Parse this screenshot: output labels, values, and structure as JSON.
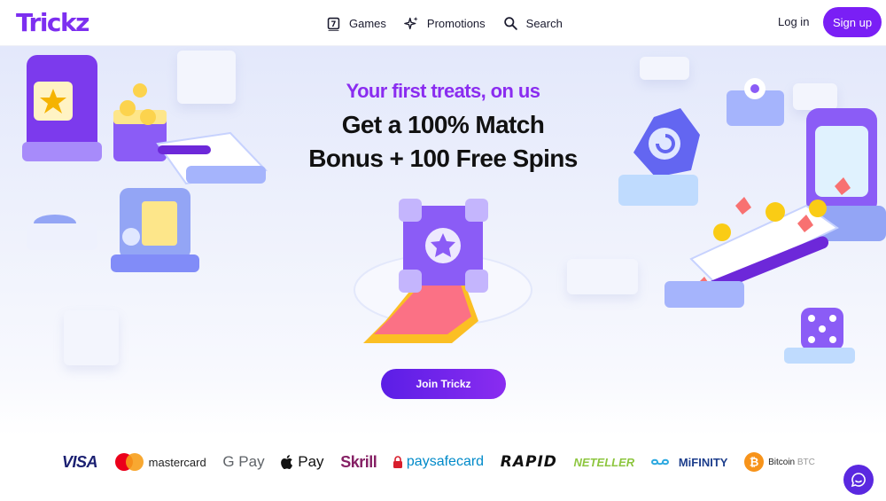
{
  "header": {
    "logo": "Trickz",
    "nav": [
      {
        "label": "Games",
        "icon": "games-icon"
      },
      {
        "label": "Promotions",
        "icon": "sparkle-icon"
      },
      {
        "label": "Search",
        "icon": "search-icon"
      }
    ],
    "login_label": "Log in",
    "signup_label": "Sign up"
  },
  "hero": {
    "tagline": "Your first treats, on us",
    "headline_line1": "Get a 100% Match",
    "headline_line2": "Bonus + 100 Free Spins",
    "cta_label": "Join Trickz"
  },
  "payments": [
    {
      "name": "VISA"
    },
    {
      "name": "mastercard"
    },
    {
      "name": "G Pay"
    },
    {
      "name": "Pay"
    },
    {
      "name": "Skrill"
    },
    {
      "name": "paysafecard"
    },
    {
      "name": "RAPID"
    },
    {
      "name": "NETELLER"
    },
    {
      "name": "MiFINITY"
    },
    {
      "name": "Bitcoin",
      "suffix": "BTC"
    }
  ],
  "colors": {
    "brand": "#7a1ff5",
    "tagline": "#8a2cf0",
    "chat": "#5a28e0"
  }
}
